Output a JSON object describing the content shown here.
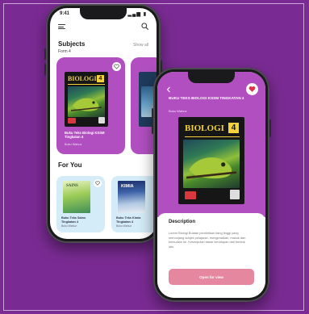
{
  "colors": {
    "background": "#7a2b93",
    "card_purple": "#b14fc1",
    "card_blue": "#d4ecf7",
    "cover_yellow": "#f3d23c",
    "button_pink": "#e4879f",
    "heart_red": "#e0324b"
  },
  "phone_home": {
    "status_time": "9:41",
    "status_signal": "▂▄▆ ▮",
    "menu_icon": "menu-icon",
    "search_icon": "search-icon",
    "subjects_title": "Subjects",
    "show_all": "Show all",
    "form_label": "Form 4",
    "featured_card": {
      "cover_title": "BIOLOGI",
      "cover_number": "4",
      "title": "Buku Teks Biologi KSSM Tingkatan 4",
      "subtitle": "Buku Wahuz",
      "fav_icon": "heart-outline-icon"
    },
    "for_you_title": "For You",
    "for_you_items": [
      {
        "cover_title": "SAINS",
        "title": "Buku Teks Sains Tingkatan 4",
        "subtitle": "Buku Wahuz",
        "fav_icon": "heart-outline-icon"
      },
      {
        "cover_title": "KIMIA",
        "title": "Buku Teks Kimia Tingkatan 4",
        "subtitle": "Buku Wahuz"
      }
    ]
  },
  "phone_detail": {
    "back_icon": "chevron-left-icon",
    "fav_icon": "heart-filled-icon",
    "title": "BUKU TEKS BIOLOGI KSSM TINGKATAN 4",
    "subtitle": "Buku Wahuz",
    "cover_title": "BIOLOGI",
    "cover_number": "4",
    "description_heading": "Description",
    "description_body": "Lorem Biologi Buatan pendidikan tiang tinggi yang menunjang subjek pelajaran, mengenalkan, masuk dan kemudian ke. Kesimpulan dasar kehidupan dari bentuk lain.",
    "open_button": "Open for view"
  }
}
